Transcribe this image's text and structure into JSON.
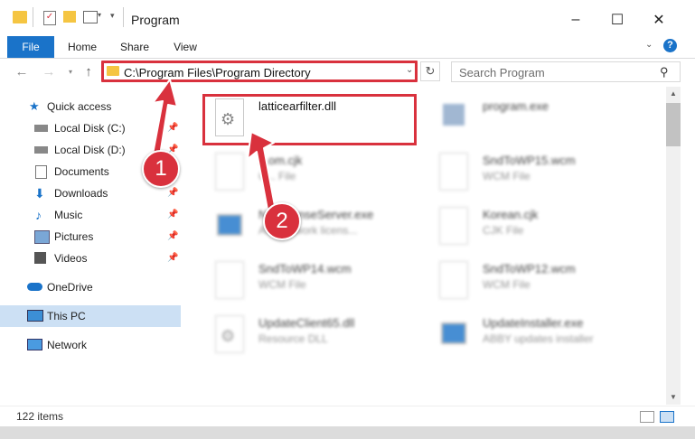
{
  "window": {
    "title": "Program",
    "controls": {
      "minimize": "–",
      "maximize": "☐",
      "close": "✕"
    }
  },
  "ribbon": {
    "tabs": [
      "File",
      "Home",
      "Share",
      "View"
    ],
    "help": "?"
  },
  "address": {
    "path": "C:\\Program Files\\Program Directory",
    "search_placeholder": "Search Program"
  },
  "sidebar": {
    "items": [
      {
        "label": "Quick access",
        "icon": "star-icon",
        "pinned": false
      },
      {
        "label": "Local Disk (C:)",
        "icon": "drive-icon",
        "pinned": true
      },
      {
        "label": "Local Disk (D:)",
        "icon": "drive-icon",
        "pinned": true
      },
      {
        "label": "Documents",
        "icon": "document-icon",
        "pinned": true
      },
      {
        "label": "Downloads",
        "icon": "download-icon",
        "pinned": true
      },
      {
        "label": "Music",
        "icon": "music-icon",
        "pinned": true
      },
      {
        "label": "Pictures",
        "icon": "pictures-icon",
        "pinned": true
      },
      {
        "label": "Videos",
        "icon": "video-icon",
        "pinned": true
      },
      {
        "label": "OneDrive",
        "icon": "cloud-icon",
        "pinned": false
      },
      {
        "label": "This PC",
        "icon": "computer-icon",
        "pinned": false,
        "selected": true
      },
      {
        "label": "Network",
        "icon": "network-icon",
        "pinned": false
      }
    ]
  },
  "files": [
    {
      "name": "latticearfilter.dll",
      "type": "",
      "highlighted": true
    },
    {
      "name": "program.exe",
      "type": "",
      "highlighted": false
    },
    {
      "name": "...om.cjk",
      "type": "C... File",
      "highlighted": false
    },
    {
      "name": "SndToWP15.wcm",
      "type": "WCM File",
      "highlighted": false
    },
    {
      "name": "N...LicenseServer.exe",
      "type": "A... Network licens...",
      "highlighted": false
    },
    {
      "name": "Korean.cjk",
      "type": "CJK File",
      "highlighted": false
    },
    {
      "name": "SndToWP14.wcm",
      "type": "WCM File",
      "highlighted": false
    },
    {
      "name": "SndToWP12.wcm",
      "type": "WCM File",
      "highlighted": false
    },
    {
      "name": "UpdateClient65.dll",
      "type": "Resource DLL",
      "highlighted": false
    },
    {
      "name": "UpdateInstaller.exe",
      "type": "ABBY updates installer",
      "highlighted": false
    }
  ],
  "status": {
    "item_count": "122 items"
  },
  "callouts": [
    "1",
    "2"
  ],
  "colors": {
    "accent": "#1a73c9",
    "highlight": "#d9313d",
    "selection": "#cce0f4"
  }
}
